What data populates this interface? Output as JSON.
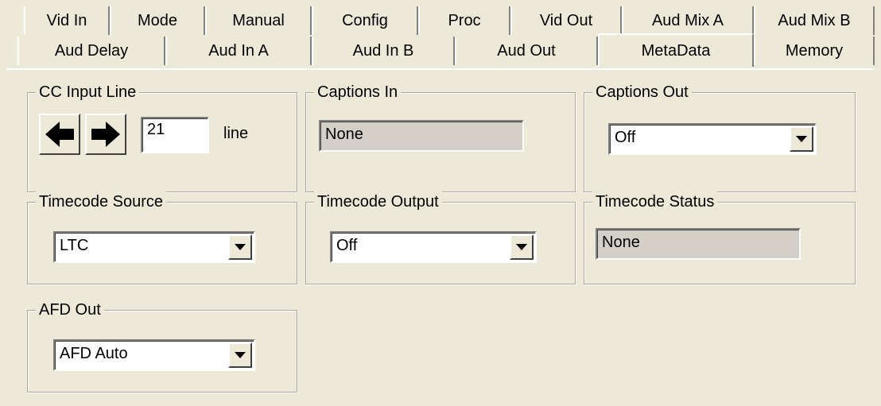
{
  "tabs_row1": [
    "Vid In",
    "Mode",
    "Manual",
    "Config",
    "Proc",
    "Vid Out",
    "Aud Mix A",
    "Aud Mix B"
  ],
  "tabs_row2": [
    "Aud Delay",
    "Aud In A",
    "Aud In B",
    "Aud Out",
    "MetaData",
    "Memory"
  ],
  "active_tab": "MetaData",
  "cc_input_line": {
    "title": "CC Input Line",
    "left_icon": "arrow-left-icon",
    "right_icon": "arrow-right-icon",
    "value": "21",
    "unit": "line"
  },
  "captions_in": {
    "title": "Captions In",
    "value": "None"
  },
  "captions_out": {
    "title": "Captions Out",
    "value": "Off"
  },
  "timecode_source": {
    "title": "Timecode Source",
    "value": "LTC"
  },
  "timecode_output": {
    "title": "Timecode Output",
    "value": "Off"
  },
  "timecode_status": {
    "title": "Timecode Status",
    "value": "None"
  },
  "afd_out": {
    "title": "AFD Out",
    "value": "AFD Auto"
  }
}
